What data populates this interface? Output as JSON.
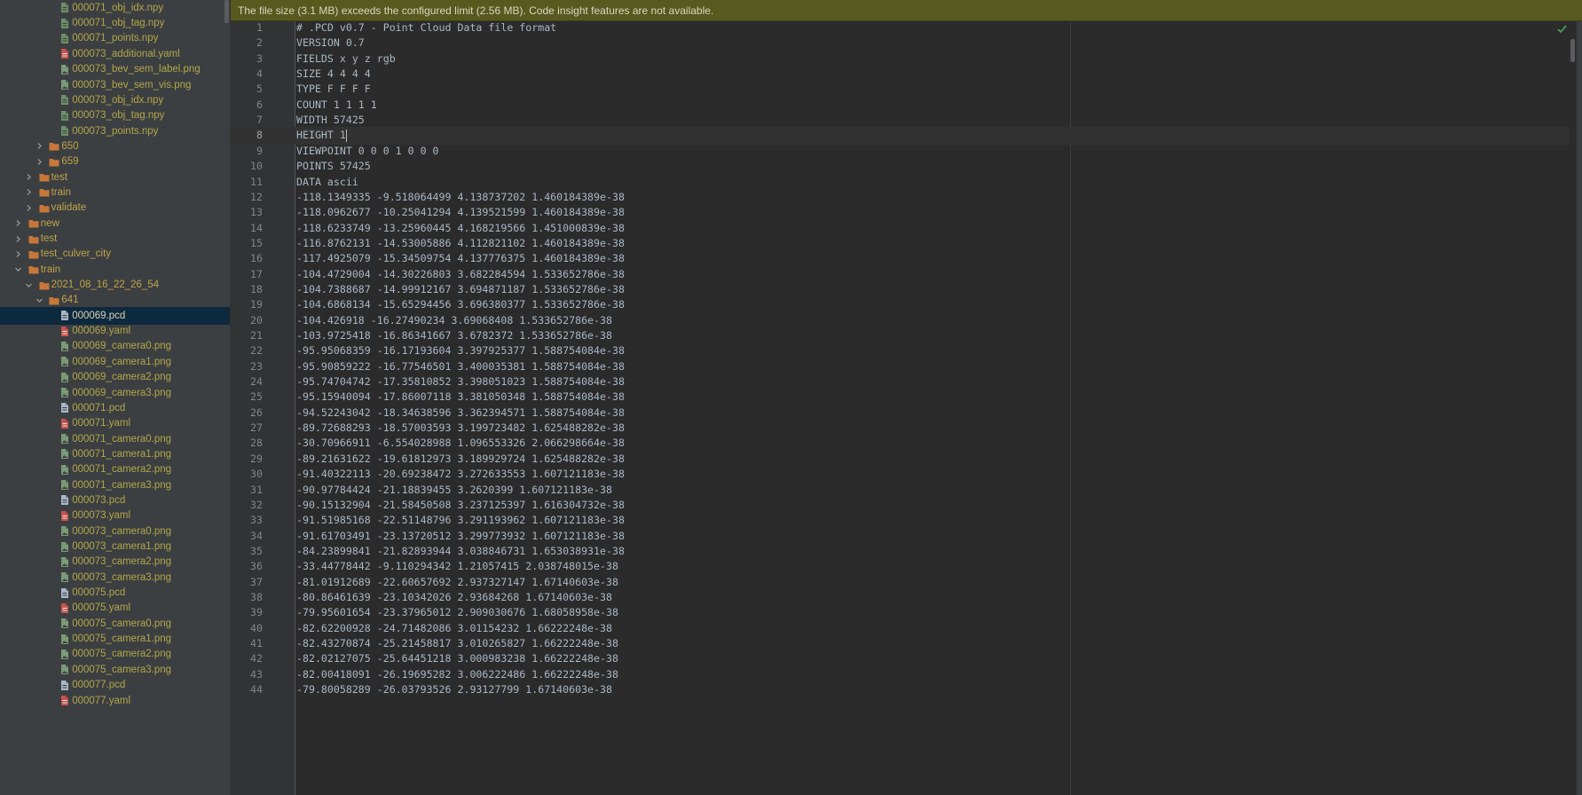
{
  "banner": {
    "message": "The file size (3.1 MB) exceeds the configured limit (2.56 MB). Code insight features are not available."
  },
  "tree": [
    {
      "label": "000071_obj_idx.npy",
      "depth": 4,
      "kind": "file",
      "icon": "npy-file-icon"
    },
    {
      "label": "000071_obj_tag.npy",
      "depth": 4,
      "kind": "file",
      "icon": "npy-file-icon"
    },
    {
      "label": "000071_points.npy",
      "depth": 4,
      "kind": "file",
      "icon": "npy-file-icon"
    },
    {
      "label": "000073_additional.yaml",
      "depth": 4,
      "kind": "file",
      "icon": "yaml-file-icon"
    },
    {
      "label": "000073_bev_sem_label.png",
      "depth": 4,
      "kind": "file",
      "icon": "image-file-icon"
    },
    {
      "label": "000073_bev_sem_vis.png",
      "depth": 4,
      "kind": "file",
      "icon": "image-file-icon"
    },
    {
      "label": "000073_obj_idx.npy",
      "depth": 4,
      "kind": "file",
      "icon": "npy-file-icon"
    },
    {
      "label": "000073_obj_tag.npy",
      "depth": 4,
      "kind": "file",
      "icon": "npy-file-icon"
    },
    {
      "label": "000073_points.npy",
      "depth": 4,
      "kind": "file",
      "icon": "npy-file-icon"
    },
    {
      "label": "650",
      "depth": 3,
      "kind": "folder",
      "expanded": false
    },
    {
      "label": "659",
      "depth": 3,
      "kind": "folder",
      "expanded": false
    },
    {
      "label": "test",
      "depth": 2,
      "kind": "folder",
      "expanded": false
    },
    {
      "label": "train",
      "depth": 2,
      "kind": "folder",
      "expanded": false
    },
    {
      "label": "validate",
      "depth": 2,
      "kind": "folder",
      "expanded": false
    },
    {
      "label": "new",
      "depth": 1,
      "kind": "folder",
      "expanded": false
    },
    {
      "label": "test",
      "depth": 1,
      "kind": "folder",
      "expanded": false
    },
    {
      "label": "test_culver_city",
      "depth": 1,
      "kind": "folder",
      "expanded": false
    },
    {
      "label": "train",
      "depth": 1,
      "kind": "folder",
      "expanded": true
    },
    {
      "label": "2021_08_16_22_26_54",
      "depth": 2,
      "kind": "folder",
      "expanded": true
    },
    {
      "label": "641",
      "depth": 3,
      "kind": "folder",
      "expanded": true
    },
    {
      "label": "000069.pcd",
      "depth": 4,
      "kind": "file",
      "icon": "text-file-icon",
      "selected": true
    },
    {
      "label": "000069.yaml",
      "depth": 4,
      "kind": "file",
      "icon": "yaml-file-icon"
    },
    {
      "label": "000069_camera0.png",
      "depth": 4,
      "kind": "file",
      "icon": "image-file-icon"
    },
    {
      "label": "000069_camera1.png",
      "depth": 4,
      "kind": "file",
      "icon": "image-file-icon"
    },
    {
      "label": "000069_camera2.png",
      "depth": 4,
      "kind": "file",
      "icon": "image-file-icon"
    },
    {
      "label": "000069_camera3.png",
      "depth": 4,
      "kind": "file",
      "icon": "image-file-icon"
    },
    {
      "label": "000071.pcd",
      "depth": 4,
      "kind": "file",
      "icon": "text-file-icon"
    },
    {
      "label": "000071.yaml",
      "depth": 4,
      "kind": "file",
      "icon": "yaml-file-icon"
    },
    {
      "label": "000071_camera0.png",
      "depth": 4,
      "kind": "file",
      "icon": "image-file-icon"
    },
    {
      "label": "000071_camera1.png",
      "depth": 4,
      "kind": "file",
      "icon": "image-file-icon"
    },
    {
      "label": "000071_camera2.png",
      "depth": 4,
      "kind": "file",
      "icon": "image-file-icon"
    },
    {
      "label": "000071_camera3.png",
      "depth": 4,
      "kind": "file",
      "icon": "image-file-icon"
    },
    {
      "label": "000073.pcd",
      "depth": 4,
      "kind": "file",
      "icon": "text-file-icon"
    },
    {
      "label": "000073.yaml",
      "depth": 4,
      "kind": "file",
      "icon": "yaml-file-icon"
    },
    {
      "label": "000073_camera0.png",
      "depth": 4,
      "kind": "file",
      "icon": "image-file-icon"
    },
    {
      "label": "000073_camera1.png",
      "depth": 4,
      "kind": "file",
      "icon": "image-file-icon"
    },
    {
      "label": "000073_camera2.png",
      "depth": 4,
      "kind": "file",
      "icon": "image-file-icon"
    },
    {
      "label": "000073_camera3.png",
      "depth": 4,
      "kind": "file",
      "icon": "image-file-icon"
    },
    {
      "label": "000075.pcd",
      "depth": 4,
      "kind": "file",
      "icon": "text-file-icon"
    },
    {
      "label": "000075.yaml",
      "depth": 4,
      "kind": "file",
      "icon": "yaml-file-icon"
    },
    {
      "label": "000075_camera0.png",
      "depth": 4,
      "kind": "file",
      "icon": "image-file-icon"
    },
    {
      "label": "000075_camera1.png",
      "depth": 4,
      "kind": "file",
      "icon": "image-file-icon"
    },
    {
      "label": "000075_camera2.png",
      "depth": 4,
      "kind": "file",
      "icon": "image-file-icon"
    },
    {
      "label": "000075_camera3.png",
      "depth": 4,
      "kind": "file",
      "icon": "image-file-icon"
    },
    {
      "label": "000077.pcd",
      "depth": 4,
      "kind": "file",
      "icon": "text-file-icon"
    },
    {
      "label": "000077.yaml",
      "depth": 4,
      "kind": "file",
      "icon": "yaml-file-icon"
    }
  ],
  "editor": {
    "current_line": 8,
    "caret_after_text": "HEIGHT 1",
    "lines": [
      {
        "n": "1",
        "text": "# .PCD v0.7 - Point Cloud Data file format"
      },
      {
        "n": "2",
        "text": "VERSION 0.7"
      },
      {
        "n": "3",
        "text": "FIELDS x y z rgb"
      },
      {
        "n": "4",
        "text": "SIZE 4 4 4 4"
      },
      {
        "n": "5",
        "text": "TYPE F F F F"
      },
      {
        "n": "6",
        "text": "COUNT 1 1 1 1"
      },
      {
        "n": "7",
        "text": "WIDTH 57425"
      },
      {
        "n": "8",
        "text": "HEIGHT 1"
      },
      {
        "n": "9",
        "text": "VIEWPOINT 0 0 0 1 0 0 0"
      },
      {
        "n": "10",
        "text": "POINTS 57425"
      },
      {
        "n": "11",
        "text": "DATA ascii"
      },
      {
        "n": "12",
        "text": "-118.1349335 -9.518064499 4.138737202 1.460184389e-38"
      },
      {
        "n": "13",
        "text": "-118.0962677 -10.25041294 4.139521599 1.460184389e-38"
      },
      {
        "n": "14",
        "text": "-118.6233749 -13.25960445 4.168219566 1.451000839e-38"
      },
      {
        "n": "15",
        "text": "-116.8762131 -14.53005886 4.112821102 1.460184389e-38"
      },
      {
        "n": "16",
        "text": "-117.4925079 -15.34509754 4.137776375 1.460184389e-38"
      },
      {
        "n": "17",
        "text": "-104.4729004 -14.30226803 3.682284594 1.533652786e-38"
      },
      {
        "n": "18",
        "text": "-104.7388687 -14.99912167 3.694871187 1.533652786e-38"
      },
      {
        "n": "19",
        "text": "-104.6868134 -15.65294456 3.696380377 1.533652786e-38"
      },
      {
        "n": "20",
        "text": "-104.426918 -16.27490234 3.69068408 1.533652786e-38"
      },
      {
        "n": "21",
        "text": "-103.9725418 -16.86341667 3.6782372 1.533652786e-38"
      },
      {
        "n": "22",
        "text": "-95.95068359 -16.17193604 3.397925377 1.588754084e-38"
      },
      {
        "n": "23",
        "text": "-95.90859222 -16.77546501 3.400035381 1.588754084e-38"
      },
      {
        "n": "24",
        "text": "-95.74704742 -17.35810852 3.398051023 1.588754084e-38"
      },
      {
        "n": "25",
        "text": "-95.15940094 -17.86007118 3.381050348 1.588754084e-38"
      },
      {
        "n": "26",
        "text": "-94.52243042 -18.34638596 3.362394571 1.588754084e-38"
      },
      {
        "n": "27",
        "text": "-89.72688293 -18.57003593 3.199723482 1.625488282e-38"
      },
      {
        "n": "28",
        "text": "-30.70966911 -6.554028988 1.096553326 2.066298664e-38"
      },
      {
        "n": "29",
        "text": "-89.21631622 -19.61812973 3.189929724 1.625488282e-38"
      },
      {
        "n": "30",
        "text": "-91.40322113 -20.69238472 3.272633553 1.607121183e-38"
      },
      {
        "n": "31",
        "text": "-90.97784424 -21.18839455 3.2620399 1.607121183e-38"
      },
      {
        "n": "32",
        "text": "-90.15132904 -21.58450508 3.237125397 1.616304732e-38"
      },
      {
        "n": "33",
        "text": "-91.51985168 -22.51148796 3.291193962 1.607121183e-38"
      },
      {
        "n": "34",
        "text": "-91.61703491 -23.13720512 3.299773932 1.607121183e-38"
      },
      {
        "n": "35",
        "text": "-84.23899841 -21.82893944 3.038846731 1.653038931e-38"
      },
      {
        "n": "36",
        "text": "-33.44778442 -9.110294342 1.21057415 2.038748015e-38"
      },
      {
        "n": "37",
        "text": "-81.01912689 -22.60657692 2.937327147 1.67140603e-38"
      },
      {
        "n": "38",
        "text": "-80.86461639 -23.10342026 2.93684268 1.67140603e-38"
      },
      {
        "n": "39",
        "text": "-79.95601654 -23.37965012 2.909030676 1.68058958e-38"
      },
      {
        "n": "40",
        "text": "-82.62200928 -24.71482086 3.01154232 1.66222248e-38"
      },
      {
        "n": "41",
        "text": "-82.43270874 -25.21458817 3.010265827 1.66222248e-38"
      },
      {
        "n": "42",
        "text": "-82.02127075 -25.64451218 3.000983238 1.66222248e-38"
      },
      {
        "n": "43",
        "text": "-82.00418091 -26.19695282 3.006222486 1.66222248e-38"
      },
      {
        "n": "44",
        "text": "-79.80058289 -26.03793526 2.93127799 1.67140603e-38"
      }
    ]
  },
  "colors": {
    "banner_bg": "#57591f",
    "editor_bg": "#2b2b2b",
    "sidebar_bg": "#3c3f41",
    "selection_bg": "#0d293e",
    "file_label": "#b2a64a",
    "folder_icon": "#c7773a",
    "code_text": "#a9b7c6"
  }
}
